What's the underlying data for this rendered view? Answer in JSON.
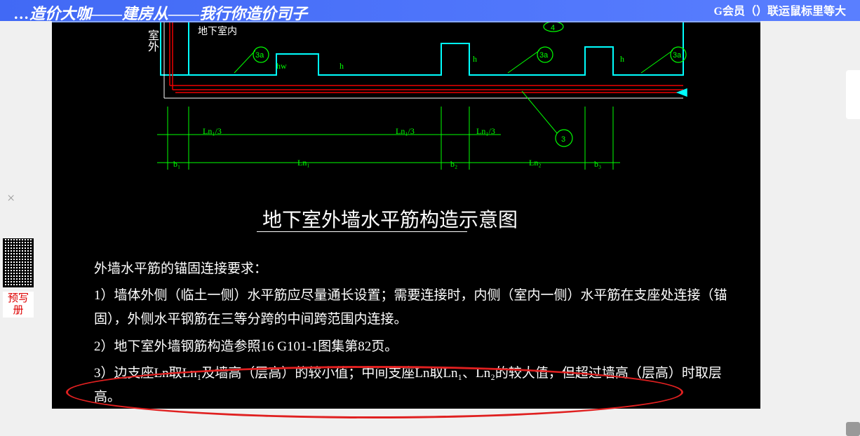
{
  "banner": {
    "left": "…造价大咖——建房从——我行你造价司子",
    "right": "G会员（）联运鼠标里等大"
  },
  "left_sidebar": {
    "close": "×",
    "qr_caption": "预写册"
  },
  "diagram": {
    "title": "地下室外墙水平筋构造示意图",
    "vertical_label_1": "室外",
    "inside_label": "地下室内",
    "circle_labels": {
      "a": "3a",
      "main": "3",
      "top": "4"
    },
    "dims": {
      "ln3_a": "Ln₁/3",
      "ln3_b": "Ln₁/3",
      "ln3_c": "Ln₁/3",
      "b1": "b₁",
      "b2": "b₂",
      "b3": "b₃",
      "ln1": "Ln₁",
      "ln2": "Ln₂",
      "h": "h",
      "hw": "hw"
    }
  },
  "notes": {
    "header": "外墙水平筋的锚固连接要求：",
    "n1": "1）墙体外侧（临土一侧）水平筋应尽量通长设置；需要连接时，内侧（室内一侧）水平筋在支座处连接（锚固），外侧水平钢筋在三等分跨的中间跨范围内连接。",
    "n2": "2）地下室外墙钢筋构造参照16 G101-1图集第82页。",
    "n3": "3）边支座Ln取Ln₁及墙高（层高）的较小值；中间支座Ln取Ln₁、Ln₂的较大值，但超过墙高（层高）时取层高。"
  }
}
